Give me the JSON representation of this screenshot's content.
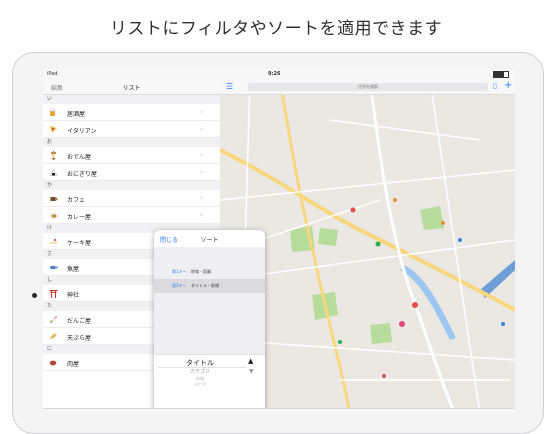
{
  "headline": "リストにフィルタやソートを適用できます",
  "status_bar": {
    "device": "iPad",
    "time": "9:26",
    "battery_level": 0.7
  },
  "sidebar": {
    "edit_label": "編集",
    "title": "リスト",
    "index_letters": [
      "あ",
      "か",
      "さ",
      "た",
      "な",
      "は",
      "ま",
      "や",
      "ら",
      "わ"
    ],
    "sections": [
      {
        "header": "い",
        "items": [
          {
            "label": "居酒屋",
            "icon": "beer-icon"
          },
          {
            "label": "イタリアン",
            "icon": "pizza-icon"
          }
        ]
      },
      {
        "header": "お",
        "items": [
          {
            "label": "おでん屋",
            "icon": "oden-icon"
          },
          {
            "label": "おにぎり屋",
            "icon": "onigiri-icon"
          }
        ]
      },
      {
        "header": "か",
        "items": [
          {
            "label": "カフェ",
            "icon": "coffee-icon"
          },
          {
            "label": "カレー屋",
            "icon": "curry-icon"
          }
        ]
      },
      {
        "header": "け",
        "items": [
          {
            "label": "ケーキ屋",
            "icon": "cake-icon"
          }
        ]
      },
      {
        "header": "さ",
        "items": [
          {
            "label": "魚屋",
            "icon": "fish-icon"
          }
        ]
      },
      {
        "header": "し",
        "items": [
          {
            "label": "神社",
            "icon": "torii-icon"
          }
        ]
      },
      {
        "header": "た",
        "items": [
          {
            "label": "だんご屋",
            "icon": "dango-icon"
          },
          {
            "label": "天ぷら屋",
            "icon": "tempura-icon"
          }
        ]
      },
      {
        "header": "に",
        "items": [
          {
            "label": "肉屋",
            "icon": "meat-icon"
          }
        ]
      }
    ]
  },
  "map": {
    "search_placeholder": "住所を検索"
  },
  "sort_popover": {
    "close_label": "閉じる",
    "title": "ソート",
    "options": [
      {
        "key": "第1キー",
        "value": "地域・距離",
        "selected": false
      },
      {
        "key": "第2キー",
        "value": "タイトル・昇順",
        "selected": true
      }
    ],
    "picker": [
      "タイトル",
      "カテゴリ",
      "地域",
      "追加日時"
    ],
    "ascending_symbol": "▲",
    "descending_symbol": "▼"
  },
  "colors": {
    "accent": "#2f7ef6",
    "map_bg": "#ebe8e3",
    "park": "#b8dc9c",
    "water": "#9cc7f0",
    "road_major": "#f9d77d"
  }
}
